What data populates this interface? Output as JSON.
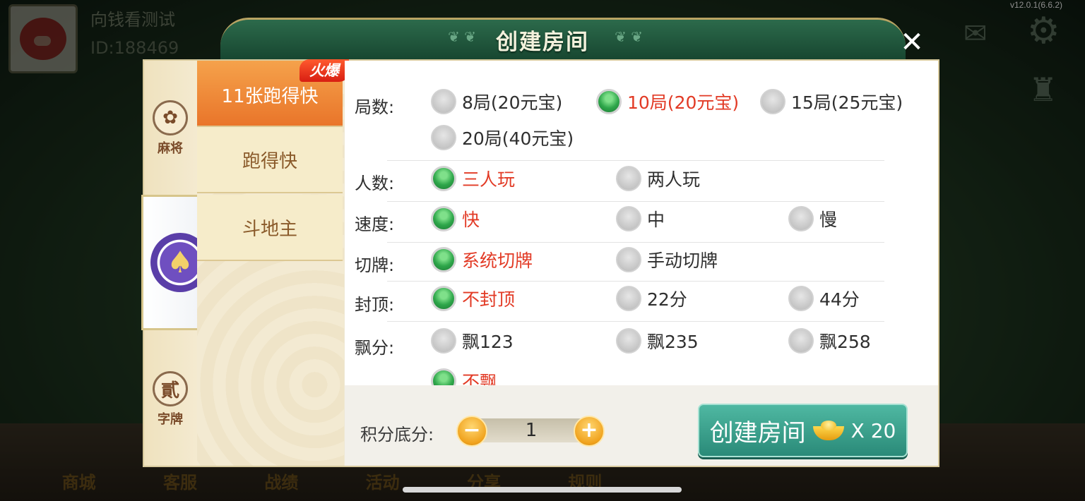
{
  "status": {
    "version": "v12.0.1(6.6.2)"
  },
  "user": {
    "name": "向钱看测试",
    "id": "ID:188469"
  },
  "bottom_nav": [
    "商城",
    "客服",
    "战绩",
    "活动",
    "分享",
    "规则"
  ],
  "dialog": {
    "title": "创建房间",
    "close_label": "✕"
  },
  "categories": [
    {
      "name": "麻将",
      "icon": "mahjong-medal-icon",
      "glyph": "✿"
    },
    {
      "name": "扑克",
      "icon": "poker-spade-icon",
      "glyph": "♠"
    },
    {
      "name": "字牌",
      "icon": "zipai-medal-icon",
      "glyph": "貳"
    }
  ],
  "games": {
    "hot_badge": "火爆",
    "tabs": [
      "11张跑得快",
      "跑得快",
      "斗地主"
    ],
    "selected": "11张跑得快"
  },
  "options": {
    "rounds": {
      "label": "局数:",
      "choices": [
        "8局(20元宝)",
        "10局(20元宝)",
        "15局(25元宝)",
        "20局(40元宝)"
      ],
      "selected": "10局(20元宝)"
    },
    "players": {
      "label": "人数:",
      "choices": [
        "三人玩",
        "两人玩"
      ],
      "selected": "三人玩"
    },
    "speed": {
      "label": "速度:",
      "choices": [
        "快",
        "中",
        "慢"
      ],
      "selected": "快"
    },
    "cut": {
      "label": "切牌:",
      "choices": [
        "系统切牌",
        "手动切牌"
      ],
      "selected": "系统切牌"
    },
    "cap": {
      "label": "封顶:",
      "choices": [
        "不封顶",
        "22分",
        "44分"
      ],
      "selected": "不封顶"
    },
    "float": {
      "label": "飘分:",
      "choices": [
        "飘123",
        "飘235",
        "飘258",
        "不飘"
      ],
      "selected": "不飘"
    }
  },
  "footer": {
    "score_label": "积分底分:",
    "score_value": "1",
    "minus": "−",
    "plus": "+",
    "create_label": "创建房间",
    "cost": "X 20"
  },
  "colors": {
    "selected_text": "#e23a25",
    "accent_green": "#2ea64a",
    "create_button": "#3a9f8b",
    "active_tab": "#ee8536"
  }
}
